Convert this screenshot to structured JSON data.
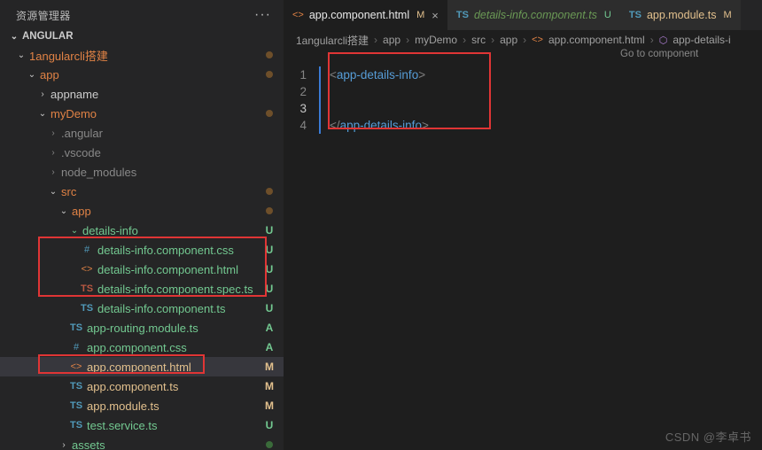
{
  "sidebar": {
    "title": "资源管理器",
    "section": "ANGULAR",
    "tree": {
      "root": "1angularcli搭建",
      "app": "app",
      "appname": "appname",
      "myDemo": "myDemo",
      "angular": ".angular",
      "vscode": ".vscode",
      "node_modules": "node_modules",
      "src": "src",
      "srcApp": "app",
      "detailsInfo": "details-info",
      "diCss": "details-info.component.css",
      "diHtml": "details-info.component.html",
      "diSpec": "details-info.component.spec.ts",
      "diTs": "details-info.component.ts",
      "routing": "app-routing.module.ts",
      "appCss": "app.component.css",
      "appHtml": "app.component.html",
      "appTs": "app.component.ts",
      "appModule": "app.module.ts",
      "testSvc": "test.service.ts",
      "assets": "assets"
    },
    "status": {
      "U": "U",
      "A": "A",
      "M": "M"
    }
  },
  "tabs": {
    "t1": {
      "label": "app.component.html",
      "status": "M"
    },
    "t2": {
      "label": "details-info.component.ts",
      "status": "U"
    },
    "t3": {
      "label": "app.module.ts",
      "status": "M"
    }
  },
  "crumbs": {
    "c1": "1angularcli搭建",
    "c2": "app",
    "c3": "myDemo",
    "c4": "src",
    "c5": "app",
    "c6": "app.component.html",
    "c7": "app-details-i"
  },
  "editor": {
    "hint": "Go to component",
    "lines": {
      "n1": "1",
      "n2": "2",
      "n3": "3",
      "n4": "4",
      "l1a": "<",
      "l1b": "app-details-info",
      "l1c": ">",
      "l4a": "</",
      "l4b": "app-details-info",
      "l4c": ">"
    }
  },
  "watermark": "CSDN @李卓书"
}
